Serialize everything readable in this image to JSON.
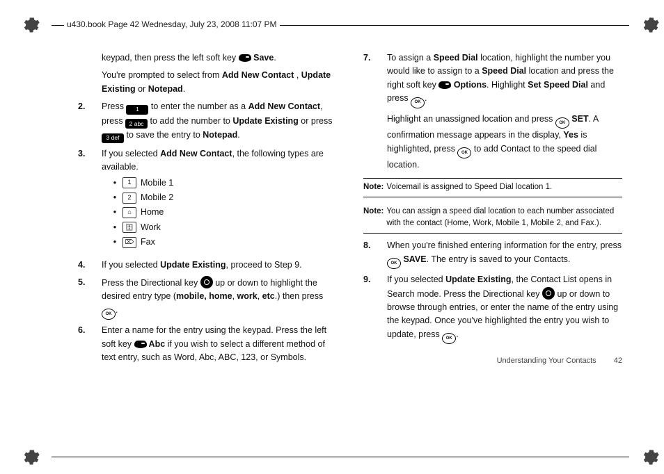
{
  "header_tag": "u430.book  Page 42  Wednesday, July 23, 2008  11:07 PM",
  "intro": {
    "p1_a": "keypad, then press the left soft key ",
    "p1_b": " Save",
    "p1_c": ".",
    "p2_a": "You're prompted to select from ",
    "p2_b": "Add New Contact",
    "p2_c": " , ",
    "p2_d": "Update Existing",
    "p2_e": " or ",
    "p2_f": "Notepad",
    "p2_g": "."
  },
  "steps": {
    "s2": {
      "num": "2.",
      "a": "Press ",
      "key1": "1",
      "b": " to enter the number as a ",
      "bold1": "Add New Contact",
      "c": ", press ",
      "key2": "2 abc",
      "d": " to add the number to ",
      "bold2": "Update Existing",
      "e": " or press ",
      "key3": "3 def",
      "f": " to save the entry to ",
      "bold3": "Notepad",
      "g": "."
    },
    "s3": {
      "num": "3.",
      "a": "If you selected ",
      "bold1": "Add New Contact",
      "b": ", the following types are available.",
      "items": [
        "Mobile 1",
        "Mobile 2",
        "Home",
        "Work",
        "Fax"
      ],
      "icons": [
        "1",
        "2",
        "⌂",
        "🗄",
        "⌦"
      ]
    },
    "s4": {
      "num": "4.",
      "a": "If you selected ",
      "bold1": "Update Existing",
      "b": ", proceed to Step 9."
    },
    "s5": {
      "num": "5.",
      "a": "Press the Directional key ",
      "b": " up or down to highlight the desired entry type (",
      "bold1": "mobile, home",
      "c": ", ",
      "bold2": "work",
      "d": ", ",
      "bold3": "etc",
      "e": ".) then press ",
      "f": "."
    },
    "s6": {
      "num": "6.",
      "a": "Enter a name for the entry using the keypad. Press the left soft key ",
      "bold1": " Abc",
      "b": " if you wish to select a different method of text entry, such as Word, Abc, ABC, 123, or Symbols."
    },
    "s7": {
      "num": "7.",
      "a": "To assign a ",
      "bold1": "Speed Dial",
      "b": " location, highlight the number you would like to assign to a ",
      "bold2": "Speed Dial",
      "c": " location and press the right soft key ",
      "bold3": " Options",
      "d": ". Highlight ",
      "bold4": "Set Speed Dial",
      "e": " and press ",
      "f": ".",
      "p2a": "Highlight an unassigned location and press ",
      "p2bold1": " SET",
      "p2b": ". A confirmation message appears in the display, ",
      "p2bold2": "Yes",
      "p2c": " is highlighted, press ",
      "p2d": " to add Contact to the speed dial location."
    },
    "s8": {
      "num": "8.",
      "a": "When you're finished entering information for the entry, press ",
      "bold1": " SAVE",
      "b": ". The entry is saved to your Contacts."
    },
    "s9": {
      "num": "9.",
      "a": "If you selected ",
      "bold1": "Update Existing",
      "b": ", the Contact List opens in Search mode. Press the Directional key ",
      "c": " up or down to browse through entries, or enter the name of the entry using the keypad. Once you've highlighted the entry you wish to update, press ",
      "d": "."
    }
  },
  "notes": {
    "label": "Note:",
    "n1": "Voicemail is assigned to Speed Dial location 1.",
    "n2": "You can assign a speed dial location to each number associated with the contact (Home, Work, Mobile 1, Mobile 2, and Fax.)."
  },
  "footer": {
    "section": "Understanding Your Contacts",
    "page": "42"
  }
}
